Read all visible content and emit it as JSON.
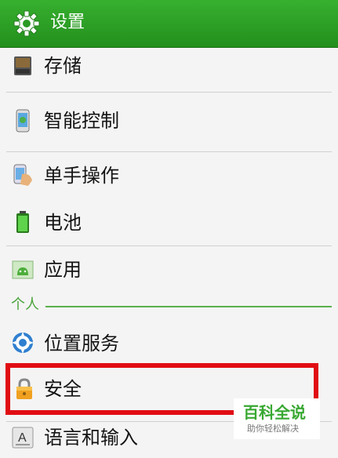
{
  "header": {
    "title": "设置",
    "color": "#2a9a24"
  },
  "items": [
    {
      "label": "存储",
      "icon": "sd-card-icon"
    },
    {
      "label": "智能控制",
      "icon": "phone-control-icon"
    },
    {
      "label": "单手操作",
      "icon": "one-hand-icon"
    },
    {
      "label": "电池",
      "icon": "battery-icon"
    },
    {
      "label": "应用",
      "icon": "android-apps-icon"
    },
    {
      "label": "位置服务",
      "icon": "location-icon"
    },
    {
      "label": "安全",
      "icon": "lock-icon"
    },
    {
      "label": "语言和输入",
      "icon": "keyboard-a-icon"
    }
  ],
  "section": {
    "label": "个人"
  },
  "highlight_color": "#e00d13",
  "watermark": {
    "main": "百科全说",
    "sub": "助你轻松解决"
  }
}
